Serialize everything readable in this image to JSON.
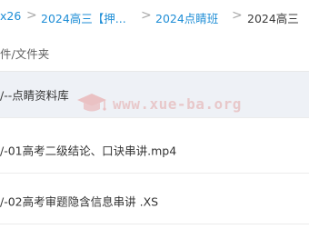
{
  "breadcrumb": {
    "items": [
      {
        "label": "x26"
      },
      {
        "label": "2024高三【押..."
      },
      {
        "label": "2024点睛班"
      },
      {
        "label": "2024高三"
      }
    ],
    "separator": ">"
  },
  "list_header": {
    "label": "件/文件夹"
  },
  "rows": [
    {
      "label": "/--点睛资料库"
    },
    {
      "label": "/-01高考二级结论、口诀串讲.mp4"
    },
    {
      "label": "/-02高考审题隐含信息串讲 .XS"
    }
  ],
  "watermark": {
    "text": "www.xue-ba.org",
    "icon": "graduation-cap-icon"
  },
  "colors": {
    "link": "#1f8ed6",
    "shaded_row": "#eef1f6",
    "watermark": "#e4a7a7"
  }
}
